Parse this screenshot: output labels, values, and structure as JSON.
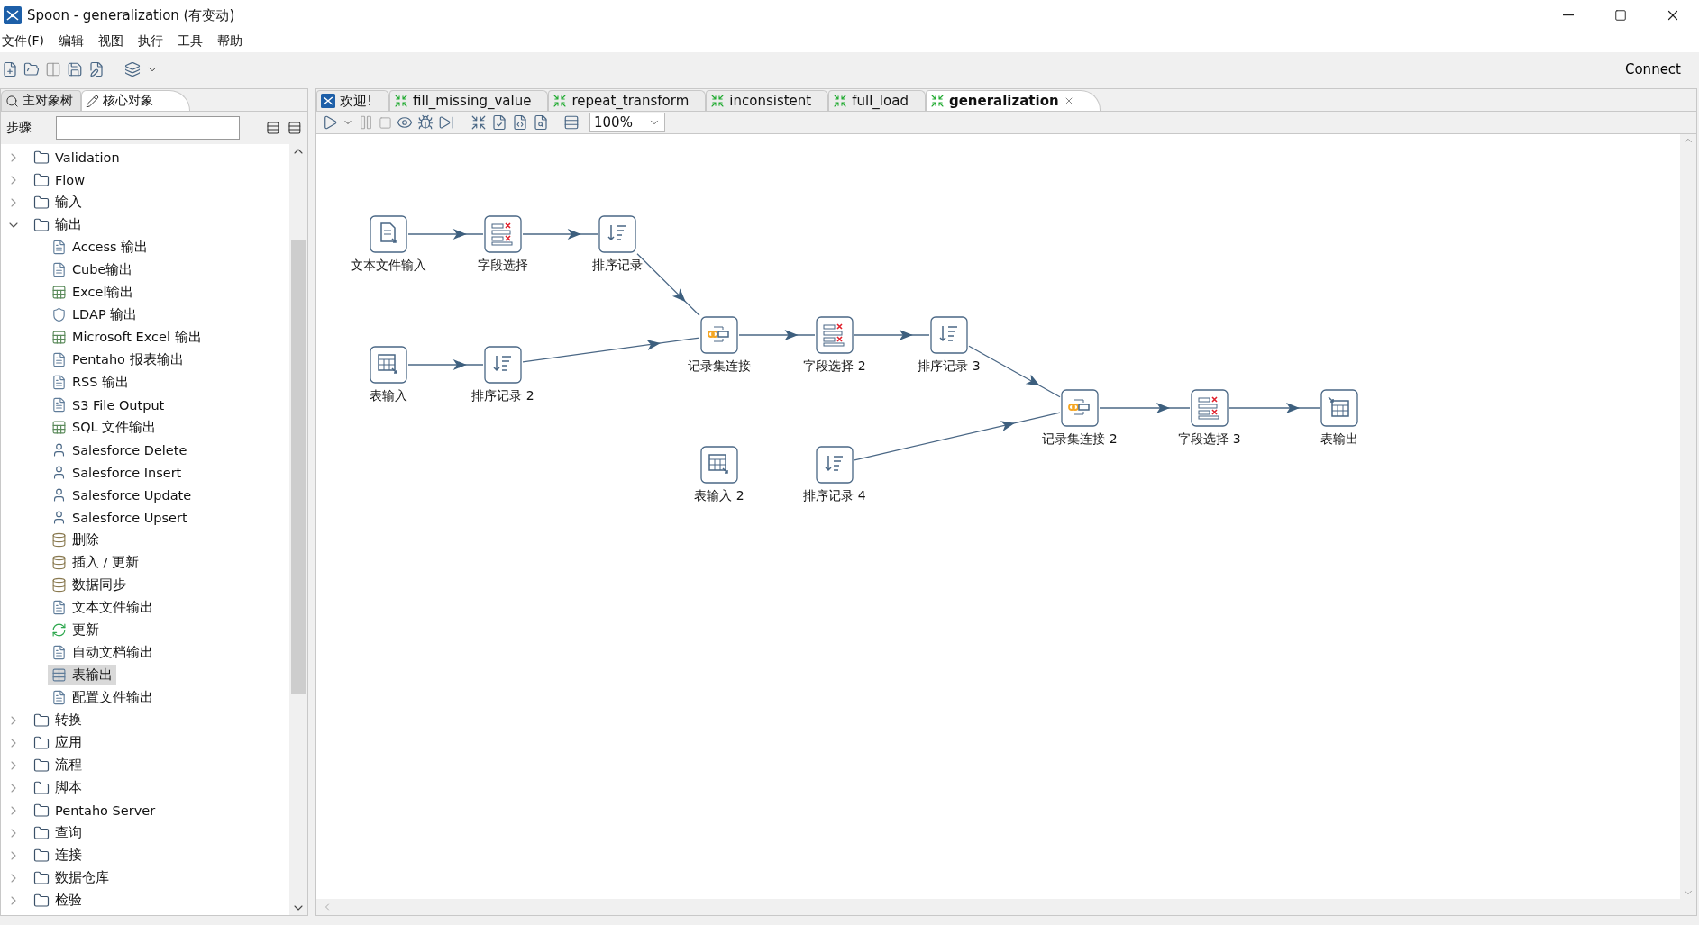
{
  "window": {
    "title": "Spoon - generalization (有变动)"
  },
  "menu": [
    "文件(F)",
    "编辑",
    "视图",
    "执行",
    "工具",
    "帮助"
  ],
  "toolbar": {
    "connect": "Connect"
  },
  "left_tabs": [
    {
      "label": "主对象树",
      "kind": "tree",
      "selected": false
    },
    {
      "label": "核心对象",
      "kind": "pencil",
      "selected": true
    }
  ],
  "steps": {
    "label": "步骤"
  },
  "tree": [
    {
      "label": "Validation",
      "expanded": false
    },
    {
      "label": "Flow",
      "expanded": false
    },
    {
      "label": "输入",
      "expanded": false
    },
    {
      "label": "输出",
      "expanded": true,
      "children": [
        {
          "label": "Access 输出",
          "kind": "doc",
          "selected": false
        },
        {
          "label": "Cube输出",
          "kind": "doc",
          "selected": false
        },
        {
          "label": "Excel输出",
          "kind": "sheet",
          "selected": false
        },
        {
          "label": "LDAP 输出",
          "kind": "shield",
          "selected": false
        },
        {
          "label": "Microsoft Excel 输出",
          "kind": "sheet",
          "selected": false
        },
        {
          "label": "Pentaho 报表输出",
          "kind": "doc",
          "selected": false
        },
        {
          "label": "RSS 输出",
          "kind": "doc",
          "selected": false
        },
        {
          "label": "S3 File Output",
          "kind": "doc",
          "selected": false
        },
        {
          "label": "SQL 文件输出",
          "kind": "sheet",
          "selected": false
        },
        {
          "label": "Salesforce Delete",
          "kind": "person",
          "selected": false
        },
        {
          "label": "Salesforce Insert",
          "kind": "person",
          "selected": false
        },
        {
          "label": "Salesforce Update",
          "kind": "person",
          "selected": false
        },
        {
          "label": "Salesforce Upsert",
          "kind": "person",
          "selected": false
        },
        {
          "label": "删除",
          "kind": "db",
          "selected": false
        },
        {
          "label": "插入 / 更新",
          "kind": "db",
          "selected": false
        },
        {
          "label": "数据同步",
          "kind": "db",
          "selected": false
        },
        {
          "label": "文本文件输出",
          "kind": "doc",
          "selected": false
        },
        {
          "label": "更新",
          "kind": "refresh",
          "selected": false
        },
        {
          "label": "自动文档输出",
          "kind": "doc",
          "selected": false
        },
        {
          "label": "表输出",
          "kind": "table",
          "selected": true
        },
        {
          "label": "配置文件输出",
          "kind": "doc",
          "selected": false
        }
      ]
    },
    {
      "label": "转换",
      "expanded": false
    },
    {
      "label": "应用",
      "expanded": false
    },
    {
      "label": "流程",
      "expanded": false
    },
    {
      "label": "脚本",
      "expanded": false
    },
    {
      "label": "Pentaho Server",
      "expanded": false
    },
    {
      "label": "查询",
      "expanded": false
    },
    {
      "label": "连接",
      "expanded": false
    },
    {
      "label": "数据仓库",
      "expanded": false
    },
    {
      "label": "检验",
      "expanded": false
    }
  ],
  "editor_tabs": [
    {
      "label": "欢迎!",
      "kind": "welcome",
      "selected": false
    },
    {
      "label": "fill_missing_value",
      "kind": "transform",
      "selected": false
    },
    {
      "label": "repeat_transform",
      "kind": "transform",
      "selected": false
    },
    {
      "label": "inconsistent",
      "kind": "transform",
      "selected": false
    },
    {
      "label": "full_load",
      "kind": "transform",
      "selected": false
    },
    {
      "label": "generalization",
      "kind": "transform",
      "selected": true
    }
  ],
  "canvas_toolbar": {
    "zoom": "100%"
  },
  "nodes": [
    {
      "label": "文本文件输入",
      "kind": "text_input"
    },
    {
      "label": "字段选择",
      "kind": "select"
    },
    {
      "label": "排序记录",
      "kind": "sort"
    },
    {
      "label": "表输入",
      "kind": "table_input"
    },
    {
      "label": "排序记录 2",
      "kind": "sort"
    },
    {
      "label": "记录集连接",
      "kind": "join"
    },
    {
      "label": "字段选择 2",
      "kind": "select"
    },
    {
      "label": "排序记录 3",
      "kind": "sort"
    },
    {
      "label": "表输入 2",
      "kind": "table_input"
    },
    {
      "label": "排序记录 4",
      "kind": "sort"
    },
    {
      "label": "记录集连接 2",
      "kind": "join"
    },
    {
      "label": "字段选择 3",
      "kind": "select"
    },
    {
      "label": "表输出",
      "kind": "table_output"
    }
  ]
}
